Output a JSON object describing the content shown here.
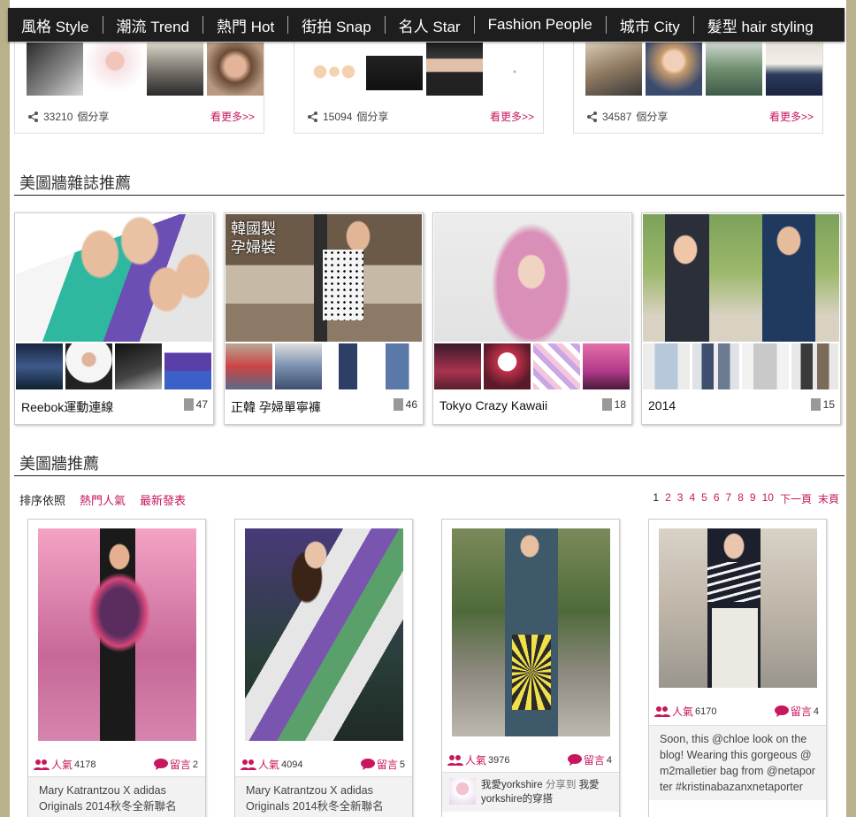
{
  "nav": [
    "風格 Style",
    "潮流 Trend",
    "熱門 Hot",
    "街拍 Snap",
    "名人 Star",
    "Fashion People",
    "城市 City",
    "髮型 hair styling"
  ],
  "top_cards": [
    {
      "share_count": "33210",
      "share_suffix": "個分享",
      "more": "看更多>>"
    },
    {
      "share_count": "15094",
      "share_suffix": "個分享",
      "more": "看更多>>"
    },
    {
      "share_count": "34587",
      "share_suffix": "個分享",
      "more": "看更多>>"
    }
  ],
  "section_magazine": "美圖牆雜誌推薦",
  "magazines": [
    {
      "title": "Reebok運動連線",
      "count": "47"
    },
    {
      "title": "正韓 孕婦單寧褲",
      "count": "46",
      "overlay": "韓國製\n孕婦裝"
    },
    {
      "title": "Tokyo Crazy Kawaii",
      "count": "18"
    },
    {
      "title": "2014",
      "count": "15"
    }
  ],
  "section_recommend": "美圖牆推薦",
  "sort": {
    "label": "排序依照",
    "options": [
      "熱門人氣",
      "最新發表"
    ]
  },
  "pager": {
    "current": "1",
    "pages": [
      "2",
      "3",
      "4",
      "5",
      "6",
      "7",
      "8",
      "9",
      "10"
    ],
    "next": "下一頁",
    "last": "末頁"
  },
  "posts": [
    {
      "pop_label": "人氣",
      "pop": "4178",
      "cmt_label": "留言",
      "cmt": "2",
      "desc": "Mary Katrantzou X adidas Originals 2014秋冬全新聯名"
    },
    {
      "pop_label": "人氣",
      "pop": "4094",
      "cmt_label": "留言",
      "cmt": "5",
      "desc": "Mary Katrantzou X adidas Originals 2014秋冬全新聯名"
    },
    {
      "pop_label": "人氣",
      "pop": "3976",
      "cmt_label": "留言",
      "cmt": "4",
      "share_user": "我愛yorkshire",
      "share_verb": "分享到",
      "share_target": "我愛yorkshire的穿搭"
    },
    {
      "pop_label": "人氣",
      "pop": "6170",
      "cmt_label": "留言",
      "cmt": "4",
      "desc": "Soon, this @chloe look on the blog! Wearing this gorgeous @m2malletier bag from @netaporter #kristinabazanxnetaporter"
    }
  ],
  "colors": {
    "accent": "#c8175e",
    "nav_bg": "#1e1e1e",
    "page_bg": "#b9b08c"
  }
}
